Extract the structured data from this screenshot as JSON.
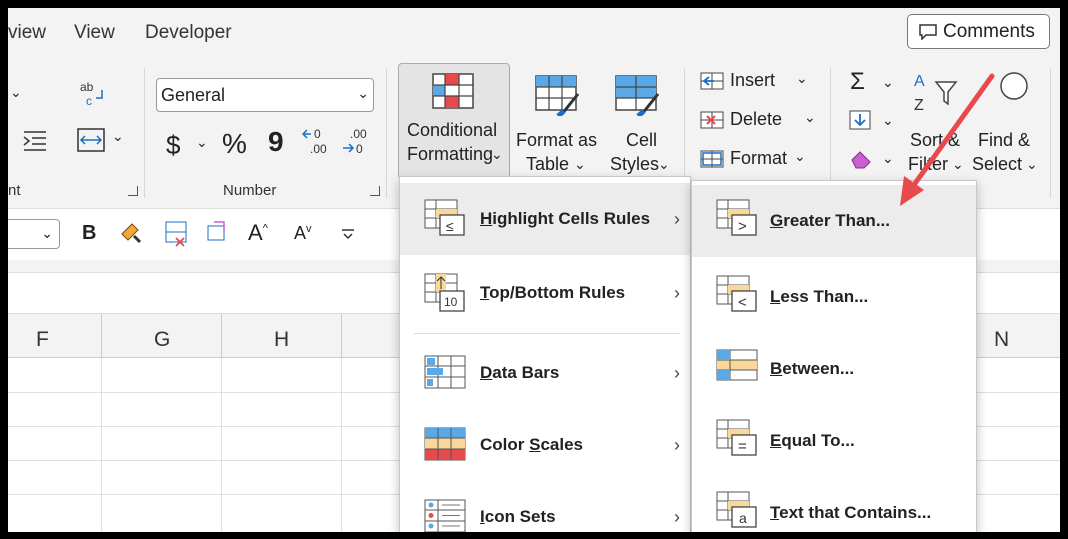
{
  "tabs": {
    "review": "view",
    "view": "View",
    "developer": "Developer"
  },
  "comments": {
    "label": "Comments"
  },
  "ribbon": {
    "group_alignment": "nt",
    "group_number": "Number",
    "number_format": "General",
    "currency": "$",
    "percent": "%",
    "comma": "9",
    "inc_dec": ".00",
    "conditional_formatting": [
      "Conditional",
      "Formatting"
    ],
    "format_as_table": [
      "Format as",
      "Table"
    ],
    "cell_styles": [
      "Cell",
      "Styles"
    ],
    "insert": "Insert",
    "delete": "Delete",
    "format": "Format",
    "sort_filter": [
      "Sort &",
      "Filter"
    ],
    "find_select": [
      "Find &",
      "Select"
    ],
    "sigma": "Σ"
  },
  "mini": {
    "bold": "B",
    "grow": "A",
    "shrink": "A"
  },
  "columns": [
    "F",
    "G",
    "H",
    "N"
  ],
  "menu1": [
    {
      "label": "Highlight Cells Rules",
      "u": "H",
      "icon": "highlight-cells-icon"
    },
    {
      "label": "Top/Bottom Rules",
      "u": "T",
      "icon": "top-bottom-icon"
    },
    {
      "label": "Data Bars",
      "u": "D",
      "icon": "data-bars-icon"
    },
    {
      "label": "Color Scales",
      "u": "S",
      "icon": "color-scales-icon"
    },
    {
      "label": "Icon Sets",
      "u": "I",
      "icon": "icon-sets-icon"
    }
  ],
  "menu2": [
    {
      "label": "Greater Than...",
      "u": "G",
      "icon": "greater-than-icon"
    },
    {
      "label": "Less Than...",
      "u": "L",
      "icon": "less-than-icon"
    },
    {
      "label": "Between...",
      "u": "B",
      "icon": "between-icon"
    },
    {
      "label": "Equal To...",
      "u": "E",
      "icon": "equal-to-icon"
    },
    {
      "label": "Text that Contains...",
      "u": "T",
      "icon": "text-contains-icon"
    }
  ],
  "colors": {
    "accent_red": "#e8494d",
    "highlight_fill": "#f9d99a",
    "cell_blue": "#5aa9e6"
  }
}
